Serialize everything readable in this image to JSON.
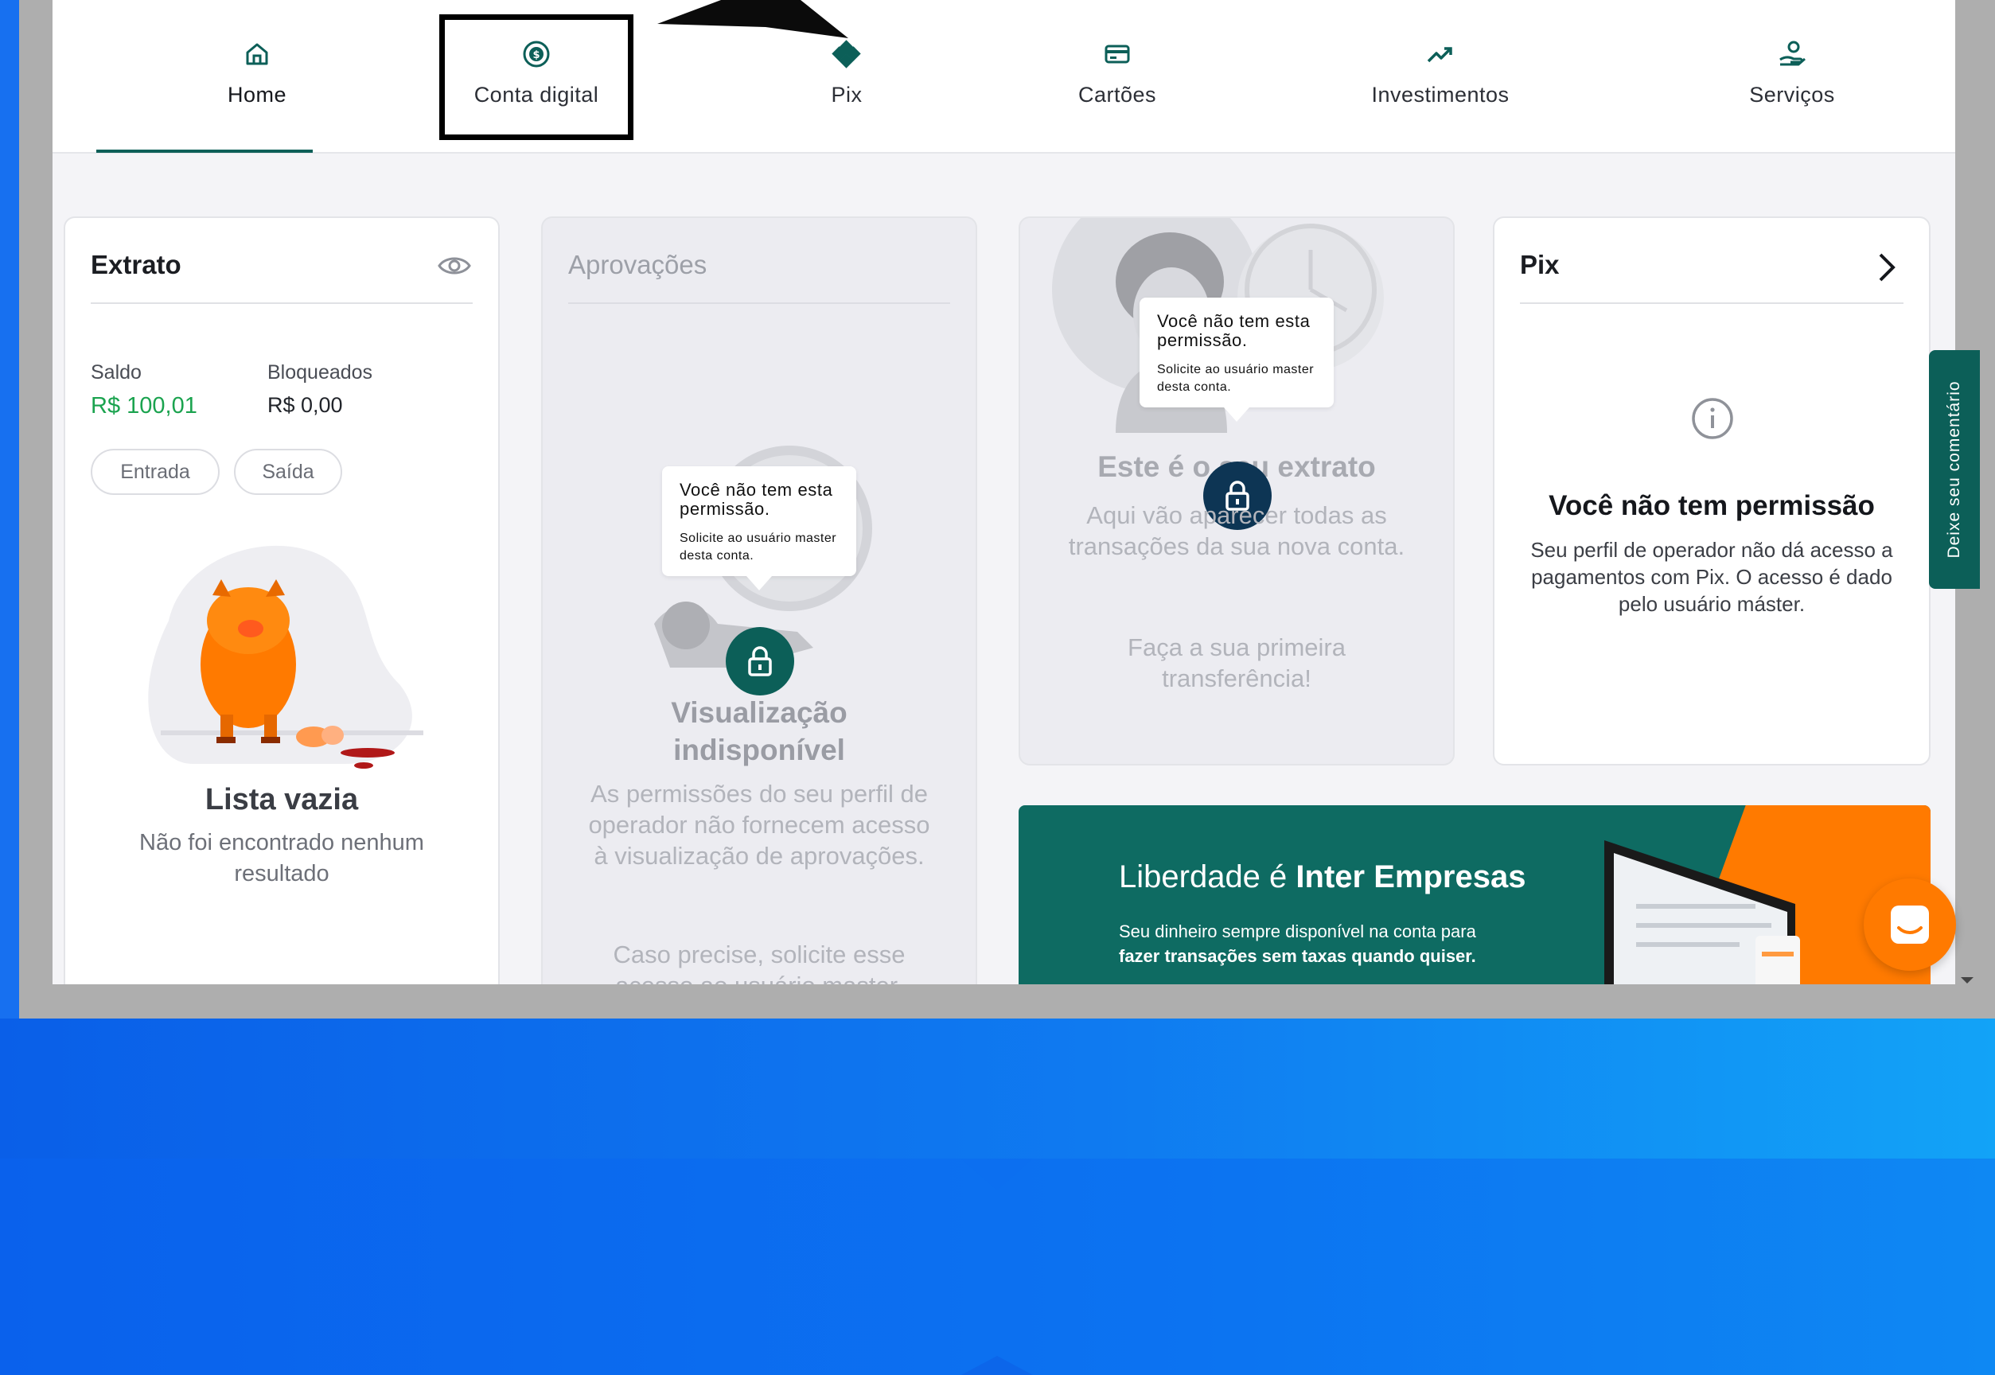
{
  "nav": {
    "items": [
      {
        "label": "Home",
        "icon": "home-icon"
      },
      {
        "label": "Conta digital",
        "icon": "dollar-circle-icon"
      },
      {
        "label": "Pix",
        "icon": "pix-icon"
      },
      {
        "label": "Cartões",
        "icon": "card-icon"
      },
      {
        "label": "Investimentos",
        "icon": "trend-up-icon"
      },
      {
        "label": "Serviços",
        "icon": "hand-service-icon"
      }
    ],
    "active": "Home"
  },
  "extrato": {
    "title": "Extrato",
    "saldo_label": "Saldo",
    "saldo_value": "R$ 100,01",
    "bloqueados_label": "Bloqueados",
    "bloqueados_value": "R$ 0,00",
    "chip_entrada": "Entrada",
    "chip_saida": "Saída",
    "empty_title": "Lista vazia",
    "empty_sub": "Não foi encontrado nenhum resultado"
  },
  "aprovacoes": {
    "title": "Aprovações",
    "tooltip_title": "Você não tem esta permissão.",
    "tooltip_sub": "Solicite ao usuário master desta conta.",
    "headline": "Visualização indisponível",
    "text1": "As permissões do seu perfil de operador não fornecem acesso à visualização de aprovações.",
    "text2": "Caso precise, solicite esse acesso ao usuário master."
  },
  "extrato_card2": {
    "tooltip_title": "Você não tem esta permissão.",
    "tooltip_sub": "Solicite ao usuário master desta conta.",
    "headline": "Este é o seu extrato",
    "text1": "Aqui vão aparecer todas as transações da sua nova conta.",
    "text2": "Faça a sua primeira transferência!"
  },
  "pix": {
    "title": "Pix",
    "no_perm_title": "Você não tem permissão",
    "no_perm_text": "Seu perfil de operador não dá acesso a pagamentos com Pix. O acesso é dado pelo usuário máster."
  },
  "banner": {
    "title_light": "Liberdade é",
    "title_bold": "Inter Empresas",
    "sub_light": "Seu dinheiro sempre disponível na conta para",
    "sub_bold": "fazer transações sem taxas quando quiser."
  },
  "feedback": {
    "label": "Deixe seu comentário"
  },
  "colors": {
    "accent": "#0c5f58",
    "positive": "#1ba34f",
    "orange": "#ff7a00",
    "background_blue": "#0a72f2"
  }
}
